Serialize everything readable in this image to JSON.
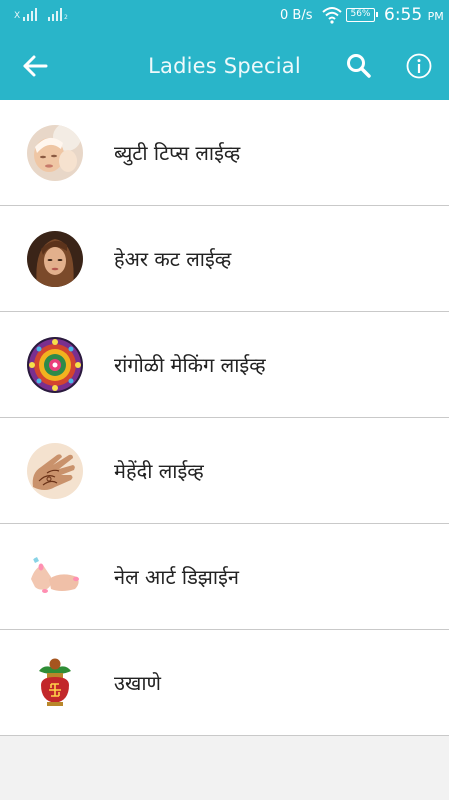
{
  "status_bar": {
    "sim1_label": "X",
    "sim2_sub": "2",
    "net_speed": "0 B/s",
    "battery": "56%",
    "time": "6:55",
    "ampm": "PM"
  },
  "toolbar": {
    "title": "Ladies Special"
  },
  "colors": {
    "primary": "#29b5c9",
    "divider": "#c9c9c9",
    "background": "#f2f2f2"
  },
  "items": [
    {
      "label": "ब्युटी टिप्स लाईव्ह",
      "icon": "beauty-face-icon"
    },
    {
      "label": "हेअर कट लाईव्ह",
      "icon": "haircut-icon"
    },
    {
      "label": "रांगोळी मेकिंग लाईव्ह",
      "icon": "rangoli-icon"
    },
    {
      "label": "मेहेंदी लाईव्ह",
      "icon": "mehendi-hand-icon"
    },
    {
      "label": "नेल आर्ट डिझाईन",
      "icon": "nail-art-icon"
    },
    {
      "label": "उखाणे",
      "icon": "kalash-icon"
    }
  ]
}
